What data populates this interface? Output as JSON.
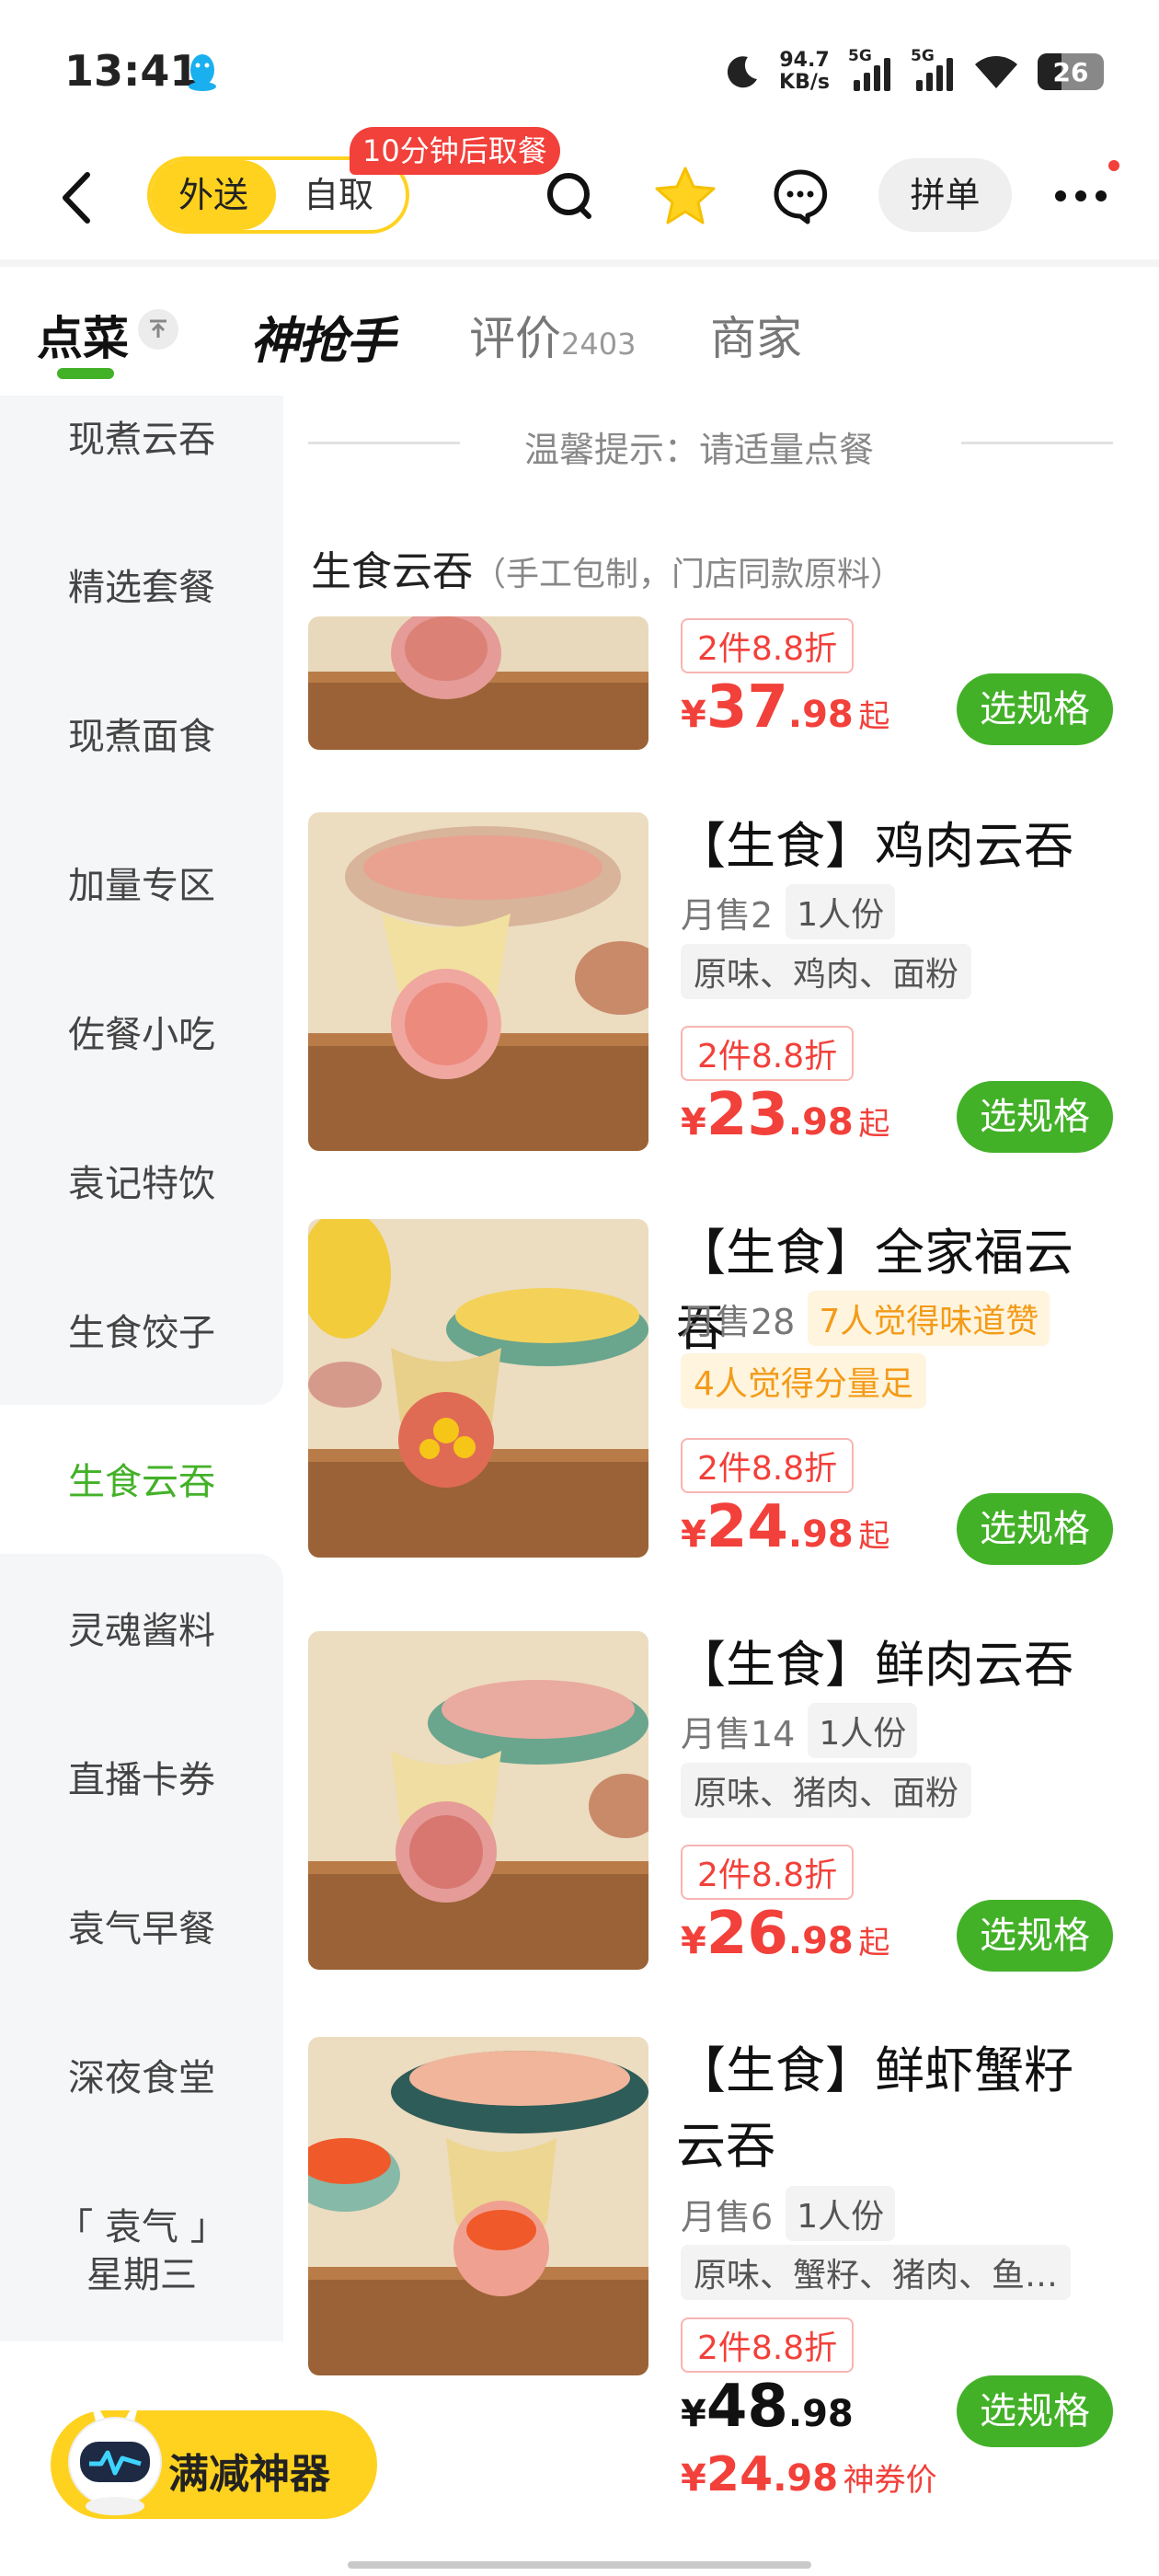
{
  "status_bar": {
    "time": "13:41",
    "net_speed_value": "94.7",
    "net_speed_unit": "KB/s",
    "sim1": "5G",
    "sim2": "5G",
    "battery": "26"
  },
  "nav": {
    "delivery_label": "外送",
    "pickup_label": "自取",
    "pickup_badge": "10分钟后取餐",
    "group_order_label": "拼单",
    "icons": [
      "back-arrow-icon",
      "search-icon",
      "favorite-star-icon",
      "chat-icon",
      "more-icon"
    ]
  },
  "tabs": {
    "order_label": "点菜",
    "brand_label": "神抢手",
    "reviews_label": "评价",
    "reviews_count": "2403",
    "merchant_label": "商家"
  },
  "sidebar": {
    "items": [
      "现煮云吞",
      "精选套餐",
      "现煮面食",
      "加量专区",
      "佐餐小吃",
      "袁记特饮",
      "生食饺子",
      "生食云吞",
      "灵魂酱料",
      "直播卡券",
      "袁气早餐",
      "深夜食堂",
      "「 袁气 」",
      "星期三"
    ],
    "active": "生食云吞"
  },
  "main": {
    "tip": "温馨提示：请适量点餐",
    "category_title": "生食云吞",
    "category_subtitle": "（手工包制，门店同款原料）"
  },
  "products": [
    {
      "name": "",
      "discount": "2件8.8折",
      "price_int": "37",
      "price_dec": ".98",
      "price_suffix": "起",
      "button": "选规格"
    },
    {
      "name": "【生食】鸡肉云吞",
      "sales": "月售2",
      "portion": "1人份",
      "tags": "原味、鸡肉、面粉",
      "discount": "2件8.8折",
      "price_int": "23",
      "price_dec": ".98",
      "price_suffix": "起",
      "button": "选规格"
    },
    {
      "name": "【生食】全家福云吞",
      "sales": "月售28",
      "badge1": "7人觉得味道赞",
      "badge2": "4人觉得分量足",
      "discount": "2件8.8折",
      "price_int": "24",
      "price_dec": ".98",
      "price_suffix": "起",
      "button": "选规格"
    },
    {
      "name": "【生食】鲜肉云吞",
      "sales": "月售14",
      "portion": "1人份",
      "tags": "原味、猪肉、面粉",
      "discount": "2件8.8折",
      "price_int": "26",
      "price_dec": ".98",
      "price_suffix": "起",
      "button": "选规格"
    },
    {
      "name": "【生食】鲜虾蟹籽云吞",
      "sales": "月售6",
      "portion": "1人份",
      "tags": "原味、蟹籽、猪肉、鱼…",
      "discount": "2件8.8折",
      "price_int": "48",
      "price_dec": ".98",
      "coupon_int": "24",
      "coupon_dec": ".98",
      "coupon_note": "神券价",
      "button": "选规格"
    }
  ],
  "currency": "¥",
  "promo": {
    "label": "满减神器"
  },
  "colors": {
    "accent_green": "#43b128",
    "brand_yellow": "#ffd21f",
    "price_red": "#f2403a",
    "badge_orange": "#f39b19"
  }
}
